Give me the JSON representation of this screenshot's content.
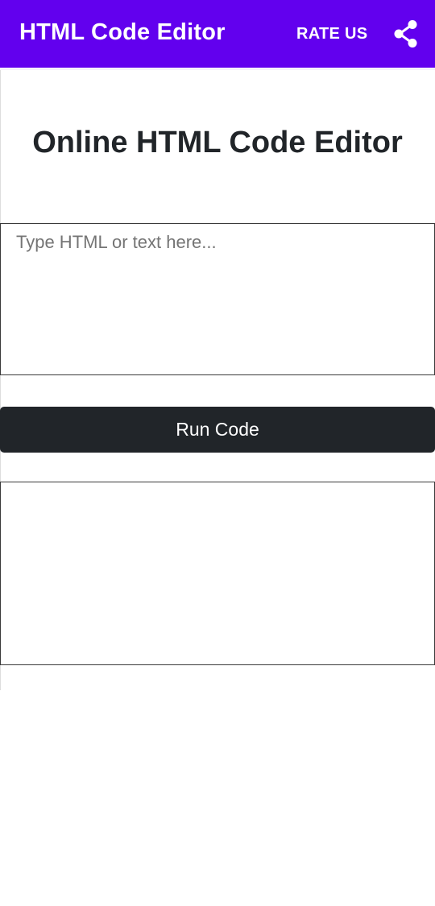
{
  "app_bar": {
    "title": "HTML Code Editor",
    "rate_us_label": "RATE US",
    "share_icon": "share-icon",
    "background_color": "#6200ee"
  },
  "main": {
    "heading": "Online HTML Code Editor",
    "code_input": {
      "placeholder": "Type HTML or text here...",
      "value": ""
    },
    "run_button_label": "Run Code",
    "output": ""
  }
}
